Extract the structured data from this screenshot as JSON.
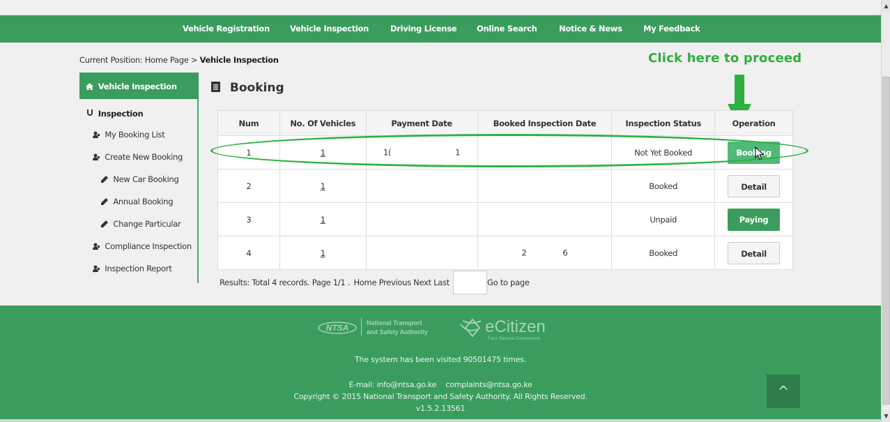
{
  "nav": {
    "items": [
      "Vehicle Registration",
      "Vehicle Inspection",
      "Driving License",
      "Online Search",
      "Notice & News",
      "My Feedback"
    ]
  },
  "breadcrumb": {
    "prefix": "Current Position: Home Page >",
    "current": "Vehicle Inspection"
  },
  "annotation": {
    "text": "Click here to proceed",
    "color": "#2eaf3c"
  },
  "sidebar": {
    "header": "Vehicle Inspection",
    "items": [
      {
        "label": "Inspection",
        "icon": "magnet-icon"
      },
      {
        "label": "My Booking List",
        "icon": "user-icon"
      },
      {
        "label": "Create New Booking",
        "icon": "user-icon"
      },
      {
        "label": "New Car Booking",
        "icon": "pencil-icon"
      },
      {
        "label": "Annual Booking",
        "icon": "pencil-icon"
      },
      {
        "label": "Change Particular",
        "icon": "pencil-icon"
      },
      {
        "label": "Compliance Inspection",
        "icon": "user-icon"
      },
      {
        "label": "Inspection Report",
        "icon": "user-icon"
      }
    ]
  },
  "page": {
    "title": "Booking"
  },
  "table": {
    "headers": [
      "Num",
      "No. Of Vehicles",
      "Payment Date",
      "Booked Inspection Date",
      "Inspection Status",
      "Operation"
    ],
    "rows": [
      {
        "num": "1",
        "vehicles": "1",
        "payment_date_left": "1(",
        "payment_date_right": "1",
        "booked_date_left": "",
        "booked_date_right": "",
        "status": "Not Yet Booked",
        "operation": "Booking"
      },
      {
        "num": "2",
        "vehicles": "1",
        "payment_date_left": "",
        "payment_date_right": "",
        "booked_date_left": "",
        "booked_date_right": "",
        "status": "Booked",
        "operation": "Detail"
      },
      {
        "num": "3",
        "vehicles": "1",
        "payment_date_left": "",
        "payment_date_right": "",
        "booked_date_left": "",
        "booked_date_right": "",
        "status": "Unpaid",
        "operation": "Paying"
      },
      {
        "num": "4",
        "vehicles": "1",
        "payment_date_left": "",
        "payment_date_right": "",
        "booked_date_left": "2",
        "booked_date_right": "6",
        "status": "Booked",
        "operation": "Detail"
      }
    ]
  },
  "pager": {
    "summary": "Results: Total 4 records. Page 1/1 .",
    "home": "Home",
    "previous": "Previous",
    "next": "Next",
    "last": "Last",
    "goto": "Go to page",
    "input_value": ""
  },
  "footer": {
    "logo1_line1": "National Transport",
    "logo1_line2": "and Safety Authority",
    "logo1_mark": "NTSA",
    "logo2_name": "eCitizen",
    "logo2_tagline": "Fast.Secure.Convenient",
    "visits": "The system has been visited 90501475 times.",
    "email_label": "E-mail: info@ntsa.go.ke",
    "email2": "complaints@ntsa.go.ke",
    "copyright": "Copyright © 2015 National Transport and Safety Authority. All Rights Reserved.",
    "version": "v1.5.2.13561",
    "to_top": "^"
  },
  "colors": {
    "primary": "#3a9d5d",
    "annotation": "#2eaf3c"
  }
}
